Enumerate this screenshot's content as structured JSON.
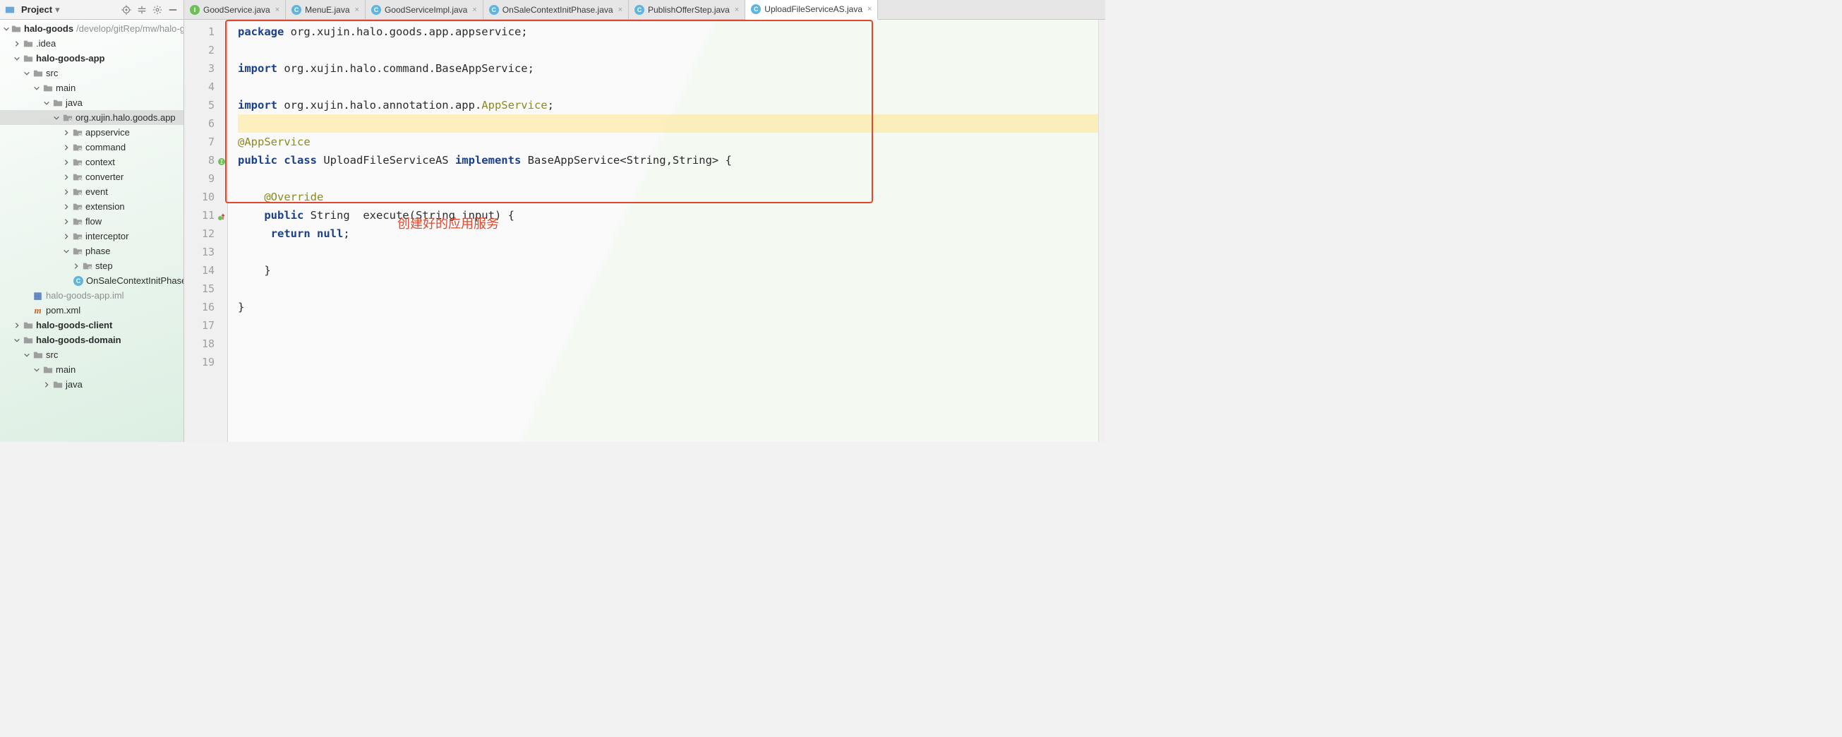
{
  "project_header": {
    "title": "Project",
    "icons": [
      "locate-icon",
      "collapse-all-icon",
      "settings-icon",
      "hide-icon"
    ]
  },
  "tree": {
    "root": {
      "name": "halo-goods",
      "path": "/develop/gitRep/mw/halo-goods"
    },
    "nodes": [
      {
        "indent": 1,
        "arrow": "right",
        "icon": "folder",
        "label": ".idea"
      },
      {
        "indent": 1,
        "arrow": "down",
        "icon": "folder",
        "label": "halo-goods-app",
        "bold": true
      },
      {
        "indent": 2,
        "arrow": "down",
        "icon": "folder",
        "label": "src"
      },
      {
        "indent": 3,
        "arrow": "down",
        "icon": "folder",
        "label": "main"
      },
      {
        "indent": 4,
        "arrow": "down",
        "icon": "folder",
        "label": "java"
      },
      {
        "indent": 5,
        "arrow": "down",
        "icon": "package",
        "label": "org.xujin.halo.goods.app",
        "selected": true
      },
      {
        "indent": 6,
        "arrow": "right",
        "icon": "package",
        "label": "appservice"
      },
      {
        "indent": 6,
        "arrow": "right",
        "icon": "package",
        "label": "command"
      },
      {
        "indent": 6,
        "arrow": "right",
        "icon": "package",
        "label": "context"
      },
      {
        "indent": 6,
        "arrow": "right",
        "icon": "package",
        "label": "converter"
      },
      {
        "indent": 6,
        "arrow": "right",
        "icon": "package",
        "label": "event"
      },
      {
        "indent": 6,
        "arrow": "right",
        "icon": "package",
        "label": "extension"
      },
      {
        "indent": 6,
        "arrow": "right",
        "icon": "package",
        "label": "flow"
      },
      {
        "indent": 6,
        "arrow": "right",
        "icon": "package",
        "label": "interceptor"
      },
      {
        "indent": 6,
        "arrow": "down",
        "icon": "package",
        "label": "phase"
      },
      {
        "indent": 7,
        "arrow": "right",
        "icon": "package",
        "label": "step"
      },
      {
        "indent": 7,
        "arrow": "none",
        "icon": "class",
        "label": "OnSaleContextInitPhase"
      },
      {
        "indent": 2,
        "arrow": "none",
        "icon": "iml",
        "label": "halo-goods-app.iml",
        "dim": true
      },
      {
        "indent": 2,
        "arrow": "none",
        "icon": "maven",
        "label": "pom.xml"
      },
      {
        "indent": 1,
        "arrow": "right",
        "icon": "folder",
        "label": "halo-goods-client",
        "bold": true
      },
      {
        "indent": 1,
        "arrow": "down",
        "icon": "folder",
        "label": "halo-goods-domain",
        "bold": true
      },
      {
        "indent": 2,
        "arrow": "down",
        "icon": "folder",
        "label": "src"
      },
      {
        "indent": 3,
        "arrow": "down",
        "icon": "folder",
        "label": "main"
      },
      {
        "indent": 4,
        "arrow": "right",
        "icon": "folder",
        "label": "java"
      }
    ]
  },
  "tabs": [
    {
      "icon": "interface",
      "label": "GoodService.java"
    },
    {
      "icon": "class",
      "label": "MenuE.java"
    },
    {
      "icon": "class",
      "label": "GoodServiceImpl.java"
    },
    {
      "icon": "class",
      "label": "OnSaleContextInitPhase.java"
    },
    {
      "icon": "class",
      "label": "PublishOfferStep.java"
    },
    {
      "icon": "class",
      "label": "UploadFileServiceAS.java",
      "active": true
    }
  ],
  "editor": {
    "line_count": 19,
    "highlight_line": 6,
    "gutter_marks": {
      "8": "impl",
      "11": "override"
    },
    "tokens": {
      "1": [
        {
          "t": "package",
          "c": "kw"
        },
        {
          "t": " org.xujin.halo.goods.app.appservice;",
          "c": ""
        }
      ],
      "2": [],
      "3": [
        {
          "t": "import",
          "c": "kw"
        },
        {
          "t": " org.xujin.halo.command.BaseAppService;",
          "c": ""
        }
      ],
      "4": [],
      "5": [
        {
          "t": "import",
          "c": "kw"
        },
        {
          "t": " org.xujin.halo.annotation.app.",
          "c": ""
        },
        {
          "t": "AppService",
          "c": "ann"
        },
        {
          "t": ";",
          "c": ""
        }
      ],
      "6": [],
      "7": [
        {
          "t": "@AppService",
          "c": "ann"
        }
      ],
      "8": [
        {
          "t": "public class",
          "c": "kw"
        },
        {
          "t": " UploadFileServiceAS ",
          "c": ""
        },
        {
          "t": "implements",
          "c": "kw"
        },
        {
          "t": " BaseAppService<String,String> {",
          "c": ""
        }
      ],
      "9": [],
      "10": [
        {
          "t": "    ",
          "c": ""
        },
        {
          "t": "@Override",
          "c": "ann"
        }
      ],
      "11": [
        {
          "t": "    ",
          "c": ""
        },
        {
          "t": "public",
          "c": "kw"
        },
        {
          "t": " String  execute(String input) {",
          "c": ""
        }
      ],
      "12": [
        {
          "t": "     ",
          "c": ""
        },
        {
          "t": "return null",
          "c": "kw"
        },
        {
          "t": ";",
          "c": ""
        }
      ],
      "13": [],
      "14": [
        {
          "t": "    }",
          "c": ""
        }
      ],
      "15": [],
      "16": [
        {
          "t": "}",
          "c": ""
        }
      ],
      "17": [],
      "18": [],
      "19": []
    }
  },
  "annotation": {
    "caption": "创建好的应用服务"
  }
}
